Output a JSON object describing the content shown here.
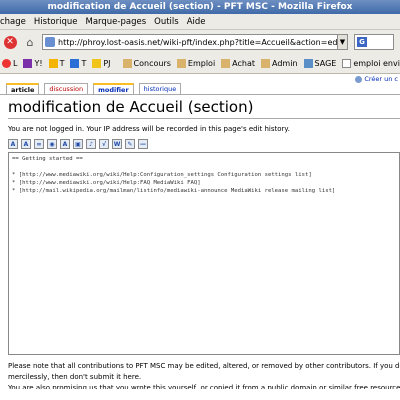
{
  "window": {
    "title": "modification de Accueil (section) - PFT MSC - Mozilla Firefox"
  },
  "menubar": {
    "items": [
      "chage",
      "Historique",
      "Marque-pages",
      "Outils",
      "Aide"
    ]
  },
  "navbar": {
    "url": "http://phroy.lost-oasis.net/wiki-pft/index.php?title=Accueil&action=edit&se",
    "search_placeholder": "G"
  },
  "bookmarks": {
    "items": [
      "L",
      "Y!",
      "T",
      "T",
      "PJ",
      "Concours",
      "Emploi",
      "Achat",
      "Admin",
      "SAGE",
      "emploi environnem"
    ]
  },
  "page": {
    "user_link": "Créer un c",
    "tabs": [
      "article",
      "discussion",
      "modifier",
      "historique"
    ],
    "title": "modification de Accueil (section)",
    "notice": "You are not logged in. Your IP address will be recorded in this page's edit history.",
    "editor_lines": [
      "== Getting started ==",
      "",
      "* [http://www.mediawiki.org/wiki/Help:Configuration_settings Configuration settings list]",
      "* [http://www.mediawiki.org/wiki/Help:FAQ MediaWiki FAQ]",
      "* [http://mail.wikipedia.org/mailman/listinfo/mediawiki-announce MediaWiki release mailing list]"
    ],
    "bottom_line1": "Please note that all contributions to PFT MSC may be edited, altered, or removed by other contributors. If you don't want yo",
    "bottom_line2": "mercilessly, then don't submit it here.",
    "bottom_line3": "You are also promising us that you wrote this yourself, or copied it from a public domain or similar free resource (see PFT M"
  }
}
